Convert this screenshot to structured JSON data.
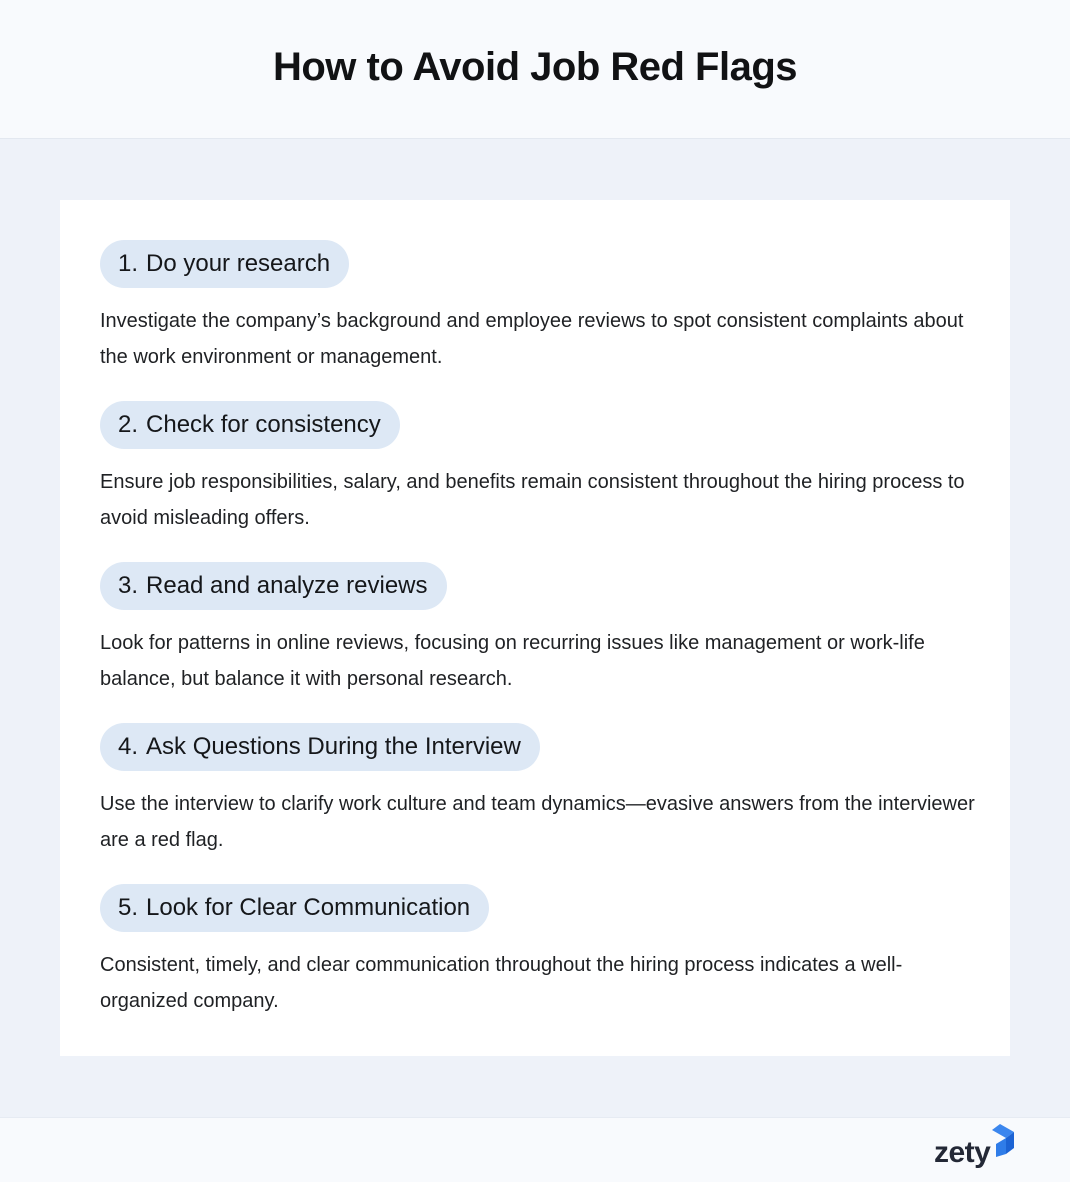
{
  "header": {
    "title": "How to Avoid Job Red Flags"
  },
  "steps": [
    {
      "number": "1.",
      "title": "Do your research",
      "description": "Investigate the company’s background and employee reviews to spot consistent complaints about the work environment or management."
    },
    {
      "number": "2.",
      "title": "Check for consistency",
      "description": "Ensure job responsibilities, salary, and benefits remain consistent throughout the hiring process to avoid misleading offers."
    },
    {
      "number": "3.",
      "title": "Read and analyze reviews",
      "description": "Look for patterns in online reviews, focusing on recurring issues like management or work-life balance, but balance it with personal research."
    },
    {
      "number": "4.",
      "title": "Ask Questions During the Interview",
      "description": "Use the interview to clarify work culture and team dynamics—evasive answers from the interviewer are a red flag."
    },
    {
      "number": "5.",
      "title": "Look for Clear Communication",
      "description": "Consistent, timely, and clear communication throughout the hiring process indicates a well-organized company."
    }
  ],
  "footer": {
    "brand": "zety",
    "brand_icon": "zety-logo-mark-icon",
    "brand_color": "#2a78e6"
  }
}
